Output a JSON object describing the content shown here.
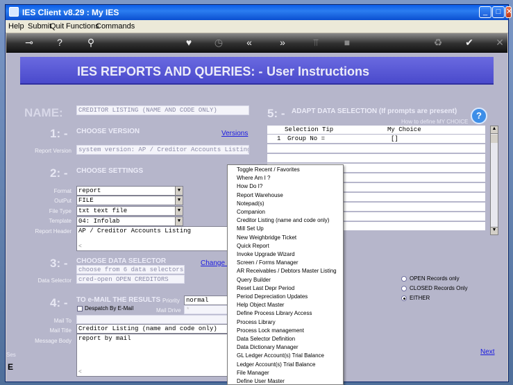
{
  "window": {
    "title": "IES Client v8.29 : My IES",
    "minimize": "_",
    "maximize": "□",
    "close": "✕"
  },
  "menubar": {
    "items": [
      "Help",
      "Submit",
      "Quit",
      "Functions",
      "Commands"
    ]
  },
  "toolbar": {
    "icons": [
      "key-icon",
      "help-icon",
      "search-icon",
      "heart-icon",
      "history-icon",
      "back-icon",
      "forward-icon",
      "tree-icon",
      "stop-icon",
      "recycle-icon",
      "check-icon",
      "close-icon"
    ]
  },
  "banner": {
    "title": "IES REPORTS AND QUERIES: -",
    "subtitle": "User Instructions"
  },
  "name_section": {
    "label": "NAME:",
    "value": "CREDITOR LISTING (NAME AND CODE ONLY)"
  },
  "step1": {
    "num": "1: -",
    "title": "CHOOSE VERSION",
    "link": "Versions",
    "report_version_label": "Report Version",
    "report_version_value": "system version: AP / Creditor Accounts Listing"
  },
  "step2": {
    "num": "2: -",
    "title": "CHOOSE SETTINGS",
    "format_label": "Format",
    "format_value": "report",
    "output_label": "OutPut",
    "output_value": "FILE",
    "filetype_label": "File Type",
    "filetype_value": "txt text file",
    "template_label": "Template",
    "template_value": "04: Infolab",
    "header_label": "Report Header",
    "header_value": "AP / Creditor Accounts Listing"
  },
  "step3": {
    "num": "3: -",
    "title": "CHOOSE DATA SELECTOR",
    "link": "Change S",
    "line1": "choose from 6 data selectors",
    "selector_label": "Data Selector",
    "selector_value": "cred-open OPEN CREDITORS"
  },
  "step4": {
    "num": "4: -",
    "title": "TO e-MAIL THE RESULTS",
    "dispatch_label": "Despatch By E-Mail",
    "priority_label": "Priority",
    "priority_value": "normal",
    "maildrive_label": "Mail Drive",
    "maildrive_value": "*",
    "mailto_label": "Mail To",
    "mailtitle_label": "Mail Title",
    "mailtitle_value": "Creditor Listing (name and code only)",
    "body_label": "Message Body",
    "body_value": "report by mail"
  },
  "step5": {
    "num": "5: -",
    "title": "ADAPT DATA SELECTION (If prompts are present)",
    "howto": "How to define MY CHOICE",
    "col_tip": "Selection Tip",
    "col_choice": "My Choice",
    "row_num": "1",
    "row_tip": "Group No =",
    "row_choice": "[]"
  },
  "records": {
    "open": "OPEN Records only",
    "closed": "CLOSED Records Only",
    "either": "EITHER",
    "selected": "EITHER"
  },
  "next_link": "Next",
  "left_stub": {
    "sep": "Ses",
    "e": "E"
  },
  "popup_menu": [
    "Toggle Recent / Favorites",
    "Where Am I ?",
    "How Do I?",
    "Report Warehouse",
    "Notepad(s)",
    "Companion",
    "Creditor Listing (name and code only)",
    "Mill Set Up",
    "New Weighbridge Ticket",
    "Quick Report",
    "Invoke Upgrade Wizard",
    "Screen / Forms Manager",
    "AR Receivables / Debtors Master Listing",
    "Query Builder",
    "Reset Last Depr Period",
    "Period Depreciation Updates",
    "Help Object Master",
    "Define Process Library Access",
    "Process Library",
    "Process Lock management",
    "Data Selector Definition",
    "Data Dictionary Manager",
    "GL Ledger Account(s) Trial Balance",
    "Ledger Account(s) Trial Balance",
    "File Manager",
    "Define User Master"
  ]
}
